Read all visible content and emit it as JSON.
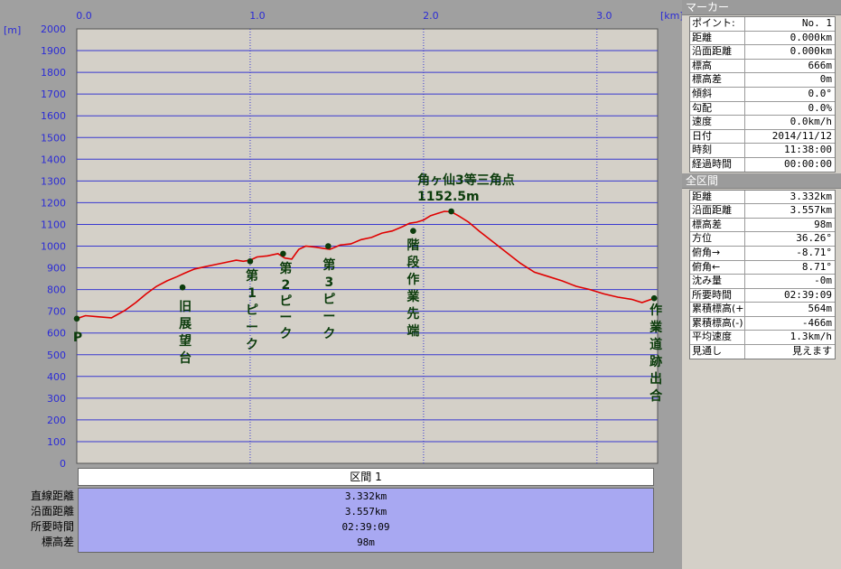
{
  "chart_data": {
    "type": "line",
    "x_unit": "[km]",
    "y_unit": "[m]",
    "xlim": [
      0,
      3.35
    ],
    "ylim": [
      0,
      2000
    ],
    "x_ticks": [
      {
        "value": 0,
        "label": "0.0"
      },
      {
        "value": 1,
        "label": "1.0"
      },
      {
        "value": 2,
        "label": "2.0"
      },
      {
        "value": 3,
        "label": "3.0"
      }
    ],
    "y_ticks": [
      0,
      100,
      200,
      300,
      400,
      500,
      600,
      700,
      800,
      900,
      1000,
      1100,
      1200,
      1300,
      1400,
      1500,
      1600,
      1700,
      1800,
      1900,
      2000
    ],
    "line_color": "#e00000",
    "plot_bg": "#d4d0c8",
    "grid": true,
    "series": [
      {
        "x": [
          0.0,
          0.05,
          0.12,
          0.2,
          0.28,
          0.34,
          0.4,
          0.46,
          0.52,
          0.58,
          0.62,
          0.68,
          0.74,
          0.8,
          0.86,
          0.92,
          0.96,
          1.0,
          1.04,
          1.1,
          1.16,
          1.2,
          1.24,
          1.28,
          1.32,
          1.38,
          1.42,
          1.46,
          1.52,
          1.58,
          1.64,
          1.7,
          1.76,
          1.82,
          1.88,
          1.92,
          1.96,
          2.0,
          2.04,
          2.08,
          2.12,
          2.16,
          2.2,
          2.26,
          2.32,
          2.4,
          2.48,
          2.56,
          2.64,
          2.72,
          2.8,
          2.88,
          2.96,
          3.04,
          3.12,
          3.2,
          3.26,
          3.33
        ],
        "y": [
          666,
          680,
          675,
          670,
          705,
          740,
          780,
          815,
          840,
          860,
          875,
          895,
          905,
          915,
          925,
          935,
          930,
          935,
          950,
          955,
          965,
          945,
          940,
          985,
          1000,
          995,
          990,
          985,
          1005,
          1010,
          1030,
          1040,
          1060,
          1070,
          1090,
          1105,
          1110,
          1120,
          1140,
          1150,
          1160,
          1158,
          1140,
          1110,
          1070,
          1020,
          970,
          920,
          880,
          860,
          840,
          815,
          800,
          780,
          765,
          755,
          740,
          760
        ]
      }
    ],
    "points": [
      {
        "x": 0.0,
        "y": 666,
        "label": "P"
      },
      {
        "x": 0.61,
        "y": 810,
        "label": "旧展望台"
      },
      {
        "x": 1.0,
        "y": 930,
        "label": "第1ピーク"
      },
      {
        "x": 1.19,
        "y": 965,
        "label": "第2ピーク"
      },
      {
        "x": 1.45,
        "y": 1000,
        "label": "第3ピーク"
      },
      {
        "x": 1.94,
        "y": 1070,
        "label": "階段作業先端"
      },
      {
        "x": 2.16,
        "y": 1160,
        "label": "角ヶ仙3等三角点"
      },
      {
        "x": 3.33,
        "y": 760,
        "label": "作業道跡出合"
      }
    ],
    "summit_label_line1": "角ヶ仙3等三角点",
    "summit_label_line2": "1152.5m"
  },
  "section": {
    "header": "区間 1",
    "rows": [
      {
        "label": "直線距離",
        "value": "3.332km"
      },
      {
        "label": "沿面距離",
        "value": "3.557km"
      },
      {
        "label": "所要時間",
        "value": "02:39:09"
      },
      {
        "label": "標高差",
        "value": "98m"
      }
    ]
  },
  "marker_panel": {
    "title": "マーカー",
    "rows": [
      {
        "k": "ポイント:",
        "v": "No. 1"
      },
      {
        "k": "距離",
        "v": "0.000km"
      },
      {
        "k": "沿面距離",
        "v": "0.000km"
      },
      {
        "k": "標高",
        "v": "666m"
      },
      {
        "k": "標高差",
        "v": "0m"
      },
      {
        "k": "傾斜",
        "v": "0.0°"
      },
      {
        "k": "勾配",
        "v": "0.0%"
      },
      {
        "k": "速度",
        "v": "0.0km/h"
      },
      {
        "k": "日付",
        "v": "2014/11/12"
      },
      {
        "k": "時刻",
        "v": "11:38:00"
      },
      {
        "k": "経過時間",
        "v": "00:00:00"
      }
    ]
  },
  "total_panel": {
    "title": "全区間",
    "rows": [
      {
        "k": "距離",
        "v": "3.332km"
      },
      {
        "k": "沿面距離",
        "v": "3.557km"
      },
      {
        "k": "標高差",
        "v": "98m"
      },
      {
        "k": "方位",
        "v": "36.26°"
      },
      {
        "k": "俯角→",
        "v": "-8.71°"
      },
      {
        "k": "俯角←",
        "v": "8.71°"
      },
      {
        "k": "沈み量",
        "v": "-0m"
      },
      {
        "k": "所要時間",
        "v": "02:39:09"
      },
      {
        "k": "累積標高(+)",
        "v": "564m"
      },
      {
        "k": "累積標高(-)",
        "v": "-466m"
      },
      {
        "k": "平均速度",
        "v": "1.3km/h"
      },
      {
        "k": "見通し",
        "v": "見えます"
      }
    ]
  }
}
